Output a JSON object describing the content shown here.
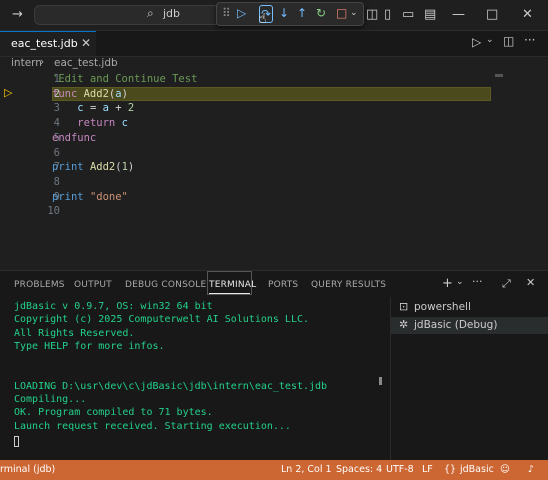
{
  "titlebar": {
    "search_text": "jdb"
  },
  "tabs": [
    {
      "label": "eac_test.jdb"
    }
  ],
  "breadcrumb": [
    "intern",
    "eac_test.jdb"
  ],
  "editor": {
    "lines": [
      {
        "num": "1",
        "segments": [
          [
            "c",
            "'Edit and Continue Test"
          ]
        ]
      },
      {
        "num": "2",
        "segments": [
          [
            "k",
            "func "
          ],
          [
            "f",
            "Add2"
          ],
          [
            "p",
            "("
          ],
          [
            "v",
            "a"
          ],
          [
            "p",
            ")"
          ]
        ]
      },
      {
        "num": "3",
        "segments": [
          [
            "p",
            "    "
          ],
          [
            "v",
            "c"
          ],
          [
            "p",
            " = "
          ],
          [
            "v",
            "a"
          ],
          [
            "p",
            " + "
          ],
          [
            "n",
            "2"
          ]
        ]
      },
      {
        "num": "4",
        "segments": [
          [
            "p",
            "    "
          ],
          [
            "k",
            "return"
          ],
          [
            "p",
            " "
          ],
          [
            "v",
            "c"
          ]
        ]
      },
      {
        "num": "5",
        "segments": [
          [
            "k",
            "endfunc"
          ]
        ]
      },
      {
        "num": "6",
        "segments": []
      },
      {
        "num": "7",
        "segments": [
          [
            "b",
            "print"
          ],
          [
            "p",
            " "
          ],
          [
            "f",
            "Add2"
          ],
          [
            "p",
            "("
          ],
          [
            "n",
            "1"
          ],
          [
            "p",
            ")"
          ]
        ]
      },
      {
        "num": "8",
        "segments": []
      },
      {
        "num": "9",
        "segments": [
          [
            "b",
            "print"
          ],
          [
            "p",
            " "
          ],
          [
            "s",
            "\"done\""
          ]
        ]
      },
      {
        "num": "10",
        "segments": []
      }
    ],
    "current_line": 2
  },
  "panel": {
    "tabs": [
      "PROBLEMS",
      "OUTPUT",
      "DEBUG CONSOLE",
      "TERMINAL",
      "PORTS",
      "QUERY RESULTS"
    ],
    "active_tab": "TERMINAL",
    "terminal_lines": [
      "jdBasic v 0.9.7, OS: win32 64 bit",
      "Copyright (c) 2025 Computerwelt AI Solutions LLC.",
      "All Rights Reserved.",
      "Type HELP for more infos.",
      "",
      "",
      "LOADING D:\\usr\\dev\\c\\jdBasic\\jdb\\intern\\eac_test.jdb",
      "Compiling...",
      "OK. Program compiled to 71 bytes.",
      "Launch request received. Starting execution..."
    ],
    "terminals": [
      "powershell",
      "jdBasic (Debug)"
    ]
  },
  "statusbar": {
    "left": "rminal (jdb)",
    "position": "Ln 2, Col 1",
    "spaces": "Spaces: 4",
    "encoding": "UTF-8",
    "eol": "LF",
    "language": "jdBasic"
  },
  "colors": {
    "accent": "#0078d4",
    "statusbar": "#cc6633",
    "terminal_text": "#23d18b"
  }
}
